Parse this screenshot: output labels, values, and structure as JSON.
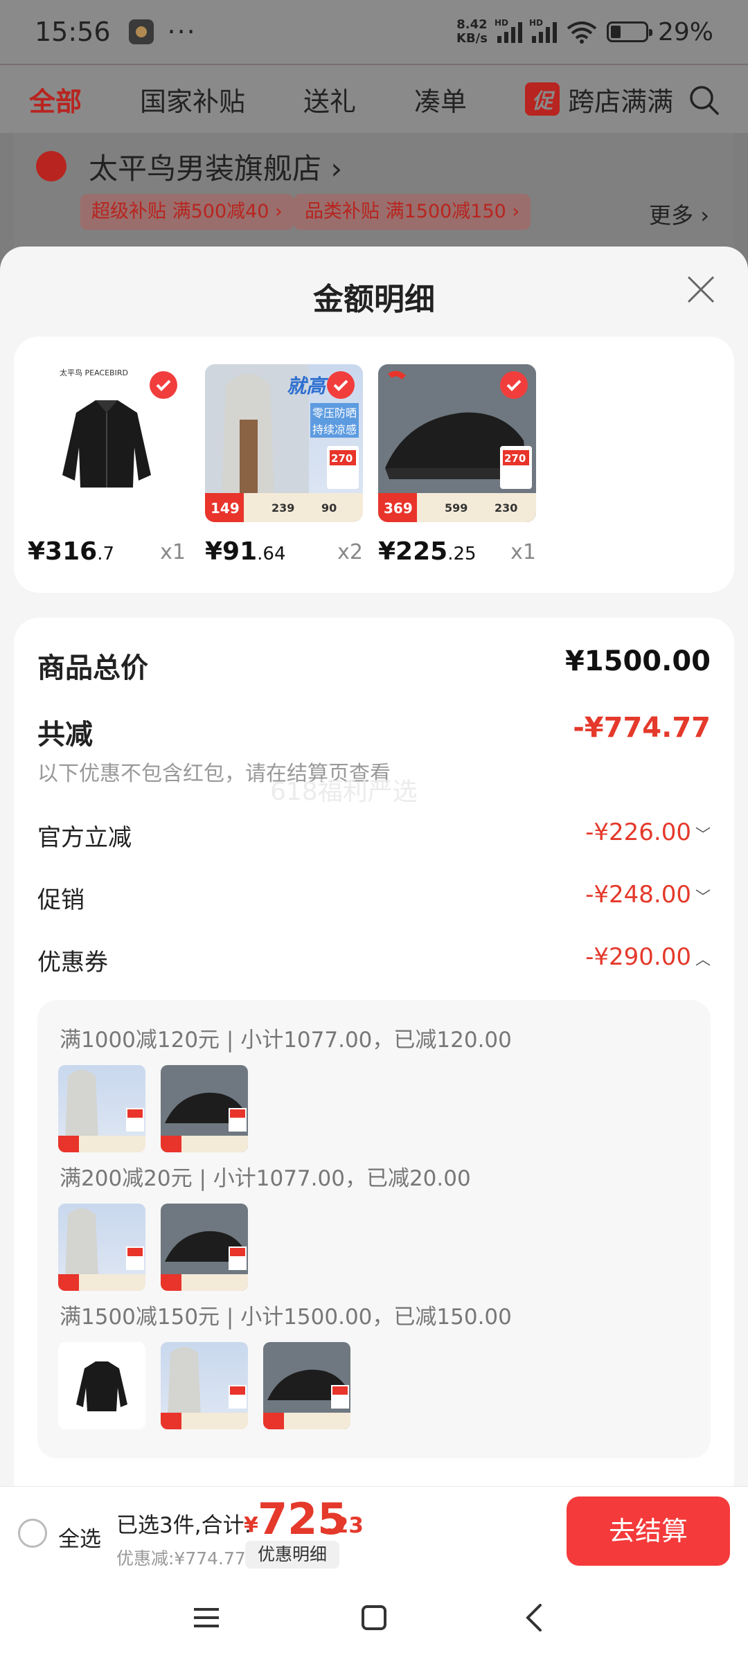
{
  "status": {
    "time": "15:56",
    "net_speed_value": "8.42",
    "net_speed_unit": "KB/s",
    "hd1": "HD",
    "hd2": "HD",
    "battery": "29%"
  },
  "filter_tabs": [
    {
      "label": "全部",
      "active": true
    },
    {
      "label": "国家补贴"
    },
    {
      "label": "送礼"
    },
    {
      "label": "凑单"
    },
    {
      "label": "跨店满满",
      "badge": "促"
    }
  ],
  "store": {
    "name": "太平鸟男装旗舰店 ›",
    "tags": [
      "超级补贴 满500减40 ›",
      "品类补贴 满1500减150 ›"
    ],
    "more": "更多 ›"
  },
  "sheet": {
    "title": "金额明细",
    "products": [
      {
        "price_int": "¥316",
        "price_dec": ".7",
        "qty": "x1",
        "image": "black-jacket",
        "brand": "太平鸟 PEACEBIRD"
      },
      {
        "price_int": "¥91",
        "price_dec": ".64",
        "qty": "x2",
        "image": "sun-hoodie",
        "promo_text": "就高",
        "promo_sub1": "零压防晒",
        "promo_sub2": "持续凉感",
        "badge_price": "270",
        "price_a": "149",
        "price_b": "239",
        "price_c": "90"
      },
      {
        "price_int": "¥225",
        "price_dec": ".25",
        "qty": "x1",
        "image": "black-sneaker",
        "badge_price": "270",
        "price_a": "369",
        "price_b": "599",
        "price_c": "230"
      }
    ],
    "summary": {
      "total_label": "商品总价",
      "total_value": "¥1500.00",
      "reduce_label": "共减",
      "reduce_value": "-¥774.77",
      "note": "以下优惠不包含红包，请在结算页查看",
      "watermark": "618福利严选",
      "items": [
        {
          "label": "官方立减",
          "value": "-¥226.00",
          "chevron": "down"
        },
        {
          "label": "促销",
          "value": "-¥248.00",
          "chevron": "down"
        },
        {
          "label": "优惠券",
          "value": "-¥290.00",
          "chevron": "up"
        }
      ],
      "coupons": [
        {
          "text": "满1000减120元 | 小计1077.00，已减120.00"
        },
        {
          "text": "满200减20元 | 小计1077.00，已减20.00"
        },
        {
          "text": "满1500减150元 | 小计1500.00，已减150.00"
        }
      ]
    }
  },
  "checkout": {
    "select_all": "全选",
    "selected": "已选3件,合计:",
    "yen": "¥",
    "total_int": "725",
    "total_dec": ".23",
    "discount": "优惠减:¥774.77",
    "detail_button": "优惠明细",
    "pay_button": "去结算"
  },
  "colors": {
    "accent_red": "#e4392b",
    "pay_button": "#f43a3a",
    "check_red": "#f23d3d"
  }
}
